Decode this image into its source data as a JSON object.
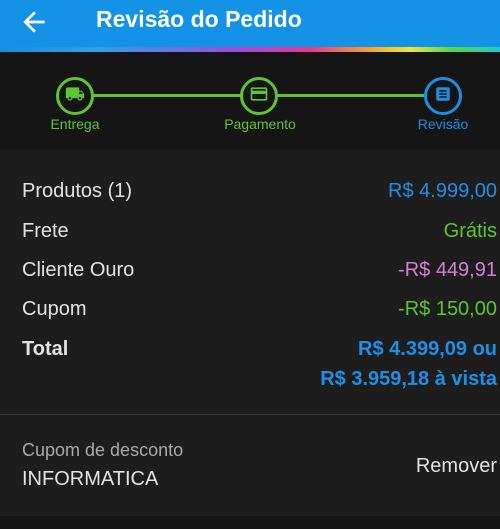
{
  "header": {
    "title": "Revisão do Pedido",
    "back_icon": "arrow-back-icon",
    "bg_color": "#1492e6"
  },
  "stepper": {
    "steps": [
      {
        "label": "Entrega",
        "icon": "truck-icon",
        "status": "done",
        "color": "#5ec42f"
      },
      {
        "label": "Pagamento",
        "icon": "credit-card-icon",
        "status": "done",
        "color": "#5ec42f"
      },
      {
        "label": "Revisão",
        "icon": "document-icon",
        "status": "current",
        "color": "#1e8fe6"
      }
    ]
  },
  "summary": {
    "products": {
      "label": "Produtos (1)",
      "value": "R$ 4.999,00",
      "color": "#1e8fe6"
    },
    "shipping": {
      "label": "Frete",
      "value": "Grátis",
      "color": "#5ec42f"
    },
    "gold_client": {
      "label": "Cliente Ouro",
      "value": "-R$ 449,91",
      "color": "#d97ed6"
    },
    "coupon": {
      "label": "Cupom",
      "value": "-R$ 150,00",
      "color": "#5ec42f"
    },
    "total": {
      "label": "Total",
      "value_line1": "R$ 4.399,09 ou",
      "value_line2": "R$ 3.959,18 à vista",
      "color": "#1e8fe6"
    }
  },
  "discount_coupon": {
    "label": "Cupom de desconto",
    "code": "INFORMATICA",
    "remove_label": "Remover"
  }
}
